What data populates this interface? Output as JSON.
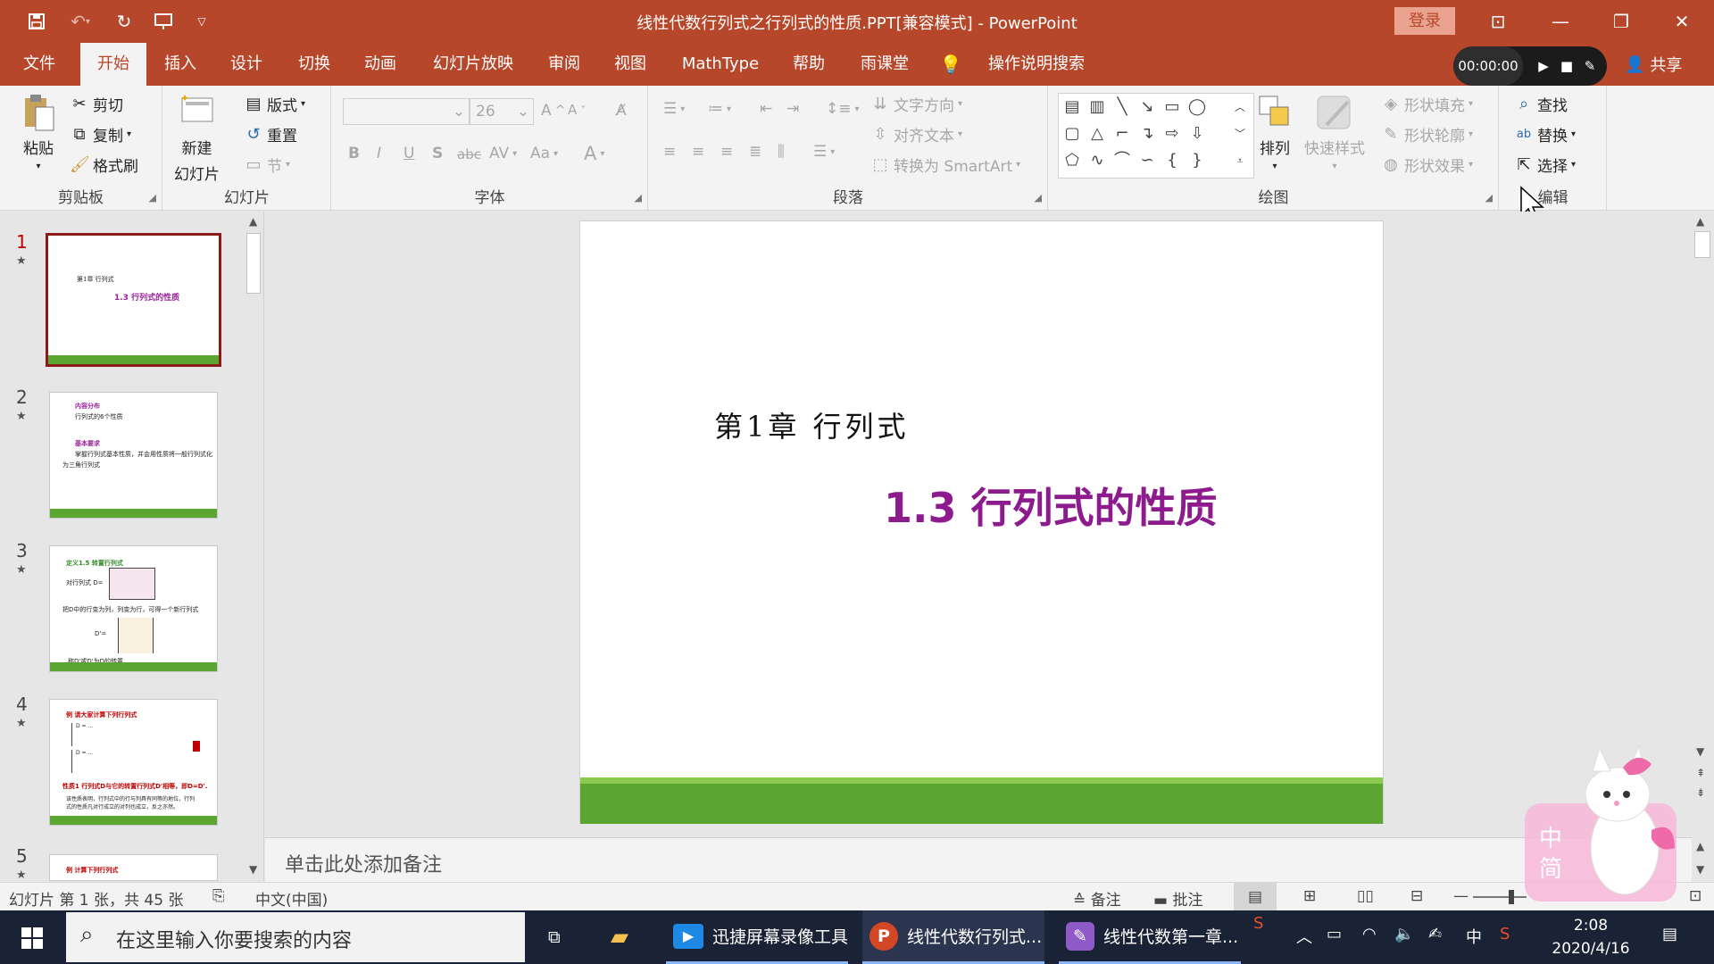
{
  "app": {
    "title": "线性代数行列式之行列式的性质.PPT[兼容模式]  -  PowerPoint",
    "login": "登录",
    "share": "共享",
    "brand_color": "#b7472a"
  },
  "tabs": [
    "文件",
    "开始",
    "插入",
    "设计",
    "切换",
    "动画",
    "幻灯片放映",
    "审阅",
    "视图",
    "MathType",
    "帮助",
    "雨课堂",
    "操作说明搜索"
  ],
  "active_tab": "开始",
  "recorder": {
    "time": "00:00:00"
  },
  "ribbon": {
    "clipboard": {
      "label": "剪贴板",
      "paste": "粘贴",
      "cut": "剪切",
      "copy": "复制",
      "format_painter": "格式刷"
    },
    "slides": {
      "label": "幻灯片",
      "new_slide_1": "新建",
      "new_slide_2": "幻灯片",
      "layout": "版式",
      "reset": "重置",
      "section": "节"
    },
    "font": {
      "label": "字体",
      "font_name": "",
      "font_size": "26",
      "bold": "B",
      "italic": "I",
      "underline": "U",
      "shadow": "S",
      "strike": "abc",
      "spacing": "AV",
      "case": "Aa",
      "color": "A"
    },
    "paragraph": {
      "label": "段落",
      "text_direction": "文字方向",
      "align_text": "对齐文本",
      "smartart": "转换为 SmartArt"
    },
    "drawing": {
      "label": "绘图",
      "arrange": "排列",
      "quick_styles": "快速样式",
      "shape_fill": "形状填充",
      "shape_outline": "形状轮廓",
      "shape_effects": "形状效果"
    },
    "editing": {
      "label": "编辑",
      "find": "查找",
      "replace": "替换",
      "select": "选择"
    }
  },
  "thumbnails": [
    {
      "num": "1",
      "lines": [
        "第1章  行列式",
        "1.3  行列式的性质"
      ]
    },
    {
      "num": "2",
      "lines": [
        "内容分布",
        "行列式的6个性质",
        "基本要求",
        "掌握行列式基本性质，并会用性质将一般行列式化",
        "为三角行列式"
      ]
    },
    {
      "num": "3",
      "lines": [
        "定义1.5  转置行列式",
        "对行列式  D=",
        "把D中的行变为列，列变为行，可得一个新行列式",
        "D'=",
        "称D'或D'为D的转置"
      ]
    },
    {
      "num": "4",
      "lines": [
        "例 请大家计算下列行列式",
        "性质1 行列式D与它的转置行列式D'相等，即D=D'.",
        "该性质表明，行列式中的行与列具有同等的地位，行列",
        "式的性质凡对行成立的对列也成立，反之亦然。"
      ]
    },
    {
      "num": "5",
      "lines": [
        "例 计算下列行列式"
      ]
    }
  ],
  "slide": {
    "chapter": "第1章  行列式",
    "title": "1.3    行列式的性质",
    "title_color": "#8e1b8e",
    "bar_color": "#5aa631"
  },
  "notes_placeholder": "单击此处添加备注",
  "status": {
    "slide_info": "幻灯片 第 1 张，共 45 张",
    "language": "中文(中国)",
    "notes": "备注",
    "comments": "批注"
  },
  "taskbar": {
    "search_placeholder": "在这里输入你要搜索的内容",
    "tasks": [
      "迅捷屏幕录像工具",
      "线性代数行列式...",
      "线性代数第一章..."
    ],
    "ime": "中",
    "time": "2:08",
    "date": "2020/4/16"
  }
}
